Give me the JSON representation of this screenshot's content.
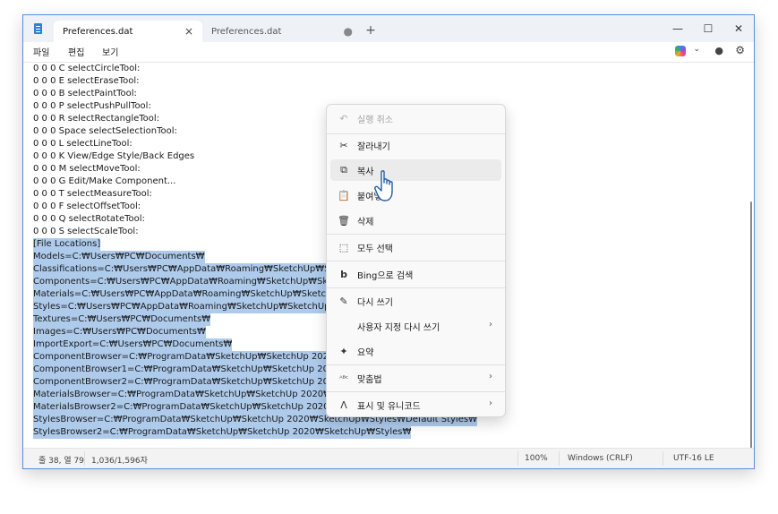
{
  "tabs": [
    {
      "label": "Preferences.dat",
      "close": "×"
    },
    {
      "label": "Preferences.dat",
      "close": "●"
    }
  ],
  "new_tab": "+",
  "window_controls": {
    "minimize": "—",
    "maximize": "☐",
    "close": "✕"
  },
  "menu": [
    "파일",
    "편집",
    "보기"
  ],
  "toolbar_icons": {
    "copilot": "copilot-icon",
    "account": "account-icon",
    "settings": "gear-icon"
  },
  "lines": [
    "0 0 0 C selectCircleTool:",
    "0 0 0 E selectEraseTool:",
    "0 0 0 B selectPaintTool:",
    "0 0 0 P selectPushPullTool:",
    "0 0 0 R selectRectangleTool:",
    "0 0 0 Space selectSelectionTool:",
    "0 0 0 L selectLineTool:",
    "0 0 0 K View/Edge Style/Back Edges",
    "0 0 0 M selectMoveTool:",
    "0 0 0 G Edit/Make Component...",
    "0 0 0 T selectMeasureTool:",
    "0 0 0 F selectOffsetTool:",
    "0 0 0 Q selectRotateTool:",
    "0 0 0 S selectScaleTool:",
    "[File Locations]",
    "Models=C:₩Users₩PC₩Documents₩",
    "Classifications=C:₩Users₩PC₩AppData₩Roaming₩SketchUp₩Sketch",
    "Components=C:₩Users₩PC₩AppData₩Roaming₩SketchUp₩SketchU",
    "Materials=C:₩Users₩PC₩AppData₩Roaming₩SketchUp₩SketchUp 2",
    "Styles=C:₩Users₩PC₩AppData₩Roaming₩SketchUp₩SketchUp 2020",
    "Textures=C:₩Users₩PC₩Documents₩",
    "Images=C:₩Users₩PC₩Documents₩",
    "ImportExport=C:₩Users₩PC₩Documents₩",
    "ComponentBrowser=C:₩ProgramData₩SketchUp₩SketchUp 2020₩S",
    "ComponentBrowser1=C:₩ProgramData₩SketchUp₩SketchUp 2020₩",
    "ComponentBrowser2=C:₩ProgramData₩SketchUp₩SketchUp 2020₩",
    "MaterialsBrowser=C:₩ProgramData₩SketchUp₩SketchUp 2020₩Sket",
    "MaterialsBrowser2=C:₩ProgramData₩SketchUp₩SketchUp 2020₩Sk",
    "StylesBrowser=C:₩ProgramData₩SketchUp₩SketchUp 2020₩SketchUp₩Styles₩Default Styles₩",
    "StylesBrowser2=C:₩ProgramData₩SketchUp₩SketchUp 2020₩SketchUp₩Styles₩"
  ],
  "status": {
    "position": "줄 38, 열 79",
    "selection": "1,036/1,596자",
    "zoom": "100%",
    "line_ending": "Windows (CRLF)",
    "encoding": "UTF-16 LE"
  },
  "context_menu": [
    {
      "label": "실행 취소",
      "icon": "undo-icon",
      "glyph": "↶"
    },
    {
      "label": "잘라내기",
      "icon": "scissors-icon",
      "glyph": "✂"
    },
    {
      "label": "복사",
      "icon": "copy-icon",
      "glyph": "⧉"
    },
    {
      "label": "붙여넣기",
      "icon": "paste-icon",
      "glyph": "📋"
    },
    {
      "label": "삭제",
      "icon": "trash-icon",
      "glyph": "🗑"
    },
    {
      "label": "모두 선택",
      "icon": "select-all-icon",
      "glyph": "⬚"
    },
    {
      "label": "Bing으로 검색",
      "icon": "bing-icon",
      "glyph": "b"
    },
    {
      "label": "다시 쓰기",
      "icon": "rewrite-icon",
      "glyph": "✎"
    },
    {
      "label": "사용자 지정 다시 쓰기",
      "icon": "",
      "glyph": ""
    },
    {
      "label": "요약",
      "icon": "summary-icon",
      "glyph": "✦"
    },
    {
      "label": "맞춤법",
      "icon": "spellcheck-icon",
      "glyph": "ᴬᴮᶜ"
    },
    {
      "label": "표시 및 유니코드",
      "icon": "unicode-icon",
      "glyph": "Λ"
    }
  ],
  "chevron": "›"
}
